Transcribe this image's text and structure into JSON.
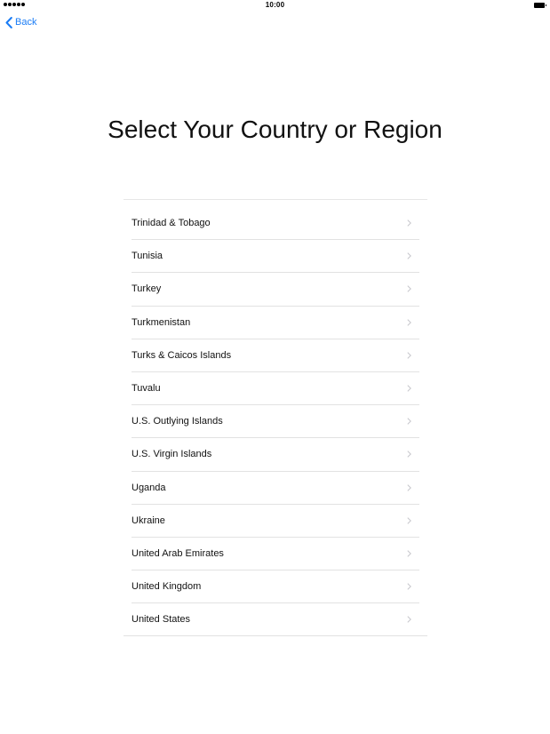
{
  "status_bar": {
    "time": "10:00"
  },
  "nav": {
    "back_label": "Back"
  },
  "title": "Select Your Country or Region",
  "countries": [
    "Trinidad & Tobago",
    "Tunisia",
    "Turkey",
    "Turkmenistan",
    "Turks & Caicos Islands",
    "Tuvalu",
    "U.S. Outlying Islands",
    "U.S. Virgin Islands",
    "Uganda",
    "Ukraine",
    "United Arab Emirates",
    "United Kingdom",
    "United States"
  ],
  "colors": {
    "accent": "#1a7cf5",
    "chevron": "#c7c7cc",
    "separator": "#e2e2e2"
  },
  "icons": {
    "back": "chevron-left-icon",
    "row": "chevron-right-icon",
    "signal": "signal-dots-icon",
    "battery": "battery-icon"
  }
}
